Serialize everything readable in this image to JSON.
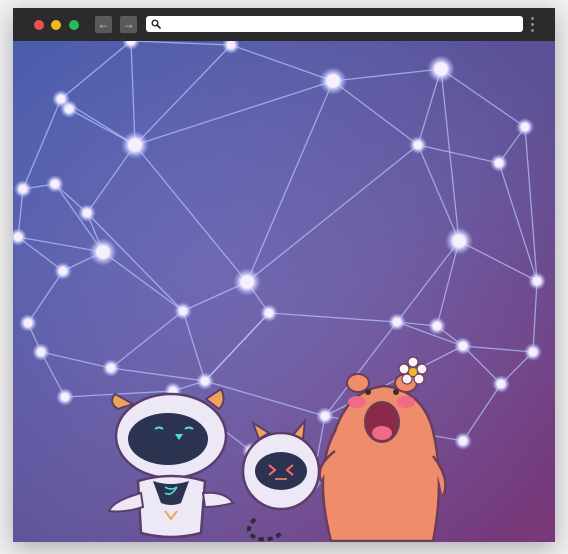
{
  "browser": {
    "address_value": "",
    "traffic_lights": {
      "close": "#ed4f51",
      "minimize": "#f5b81c",
      "zoom": "#27ba5a"
    },
    "nav": {
      "back_icon": "arrow-left-icon",
      "forward_icon": "arrow-right-icon",
      "back_glyph": "←",
      "forward_glyph": "→"
    },
    "search_icon": "search-icon",
    "menu_icon": "more-vert-icon"
  },
  "content": {
    "illustration": "hero-illustration",
    "colors": {
      "bg_top": "#4a5fb8",
      "bg_mid": "#6a5aa8",
      "bg_bottom": "#8a3e88",
      "node": "#f3ebff",
      "glow": "#7fa4ff"
    }
  }
}
